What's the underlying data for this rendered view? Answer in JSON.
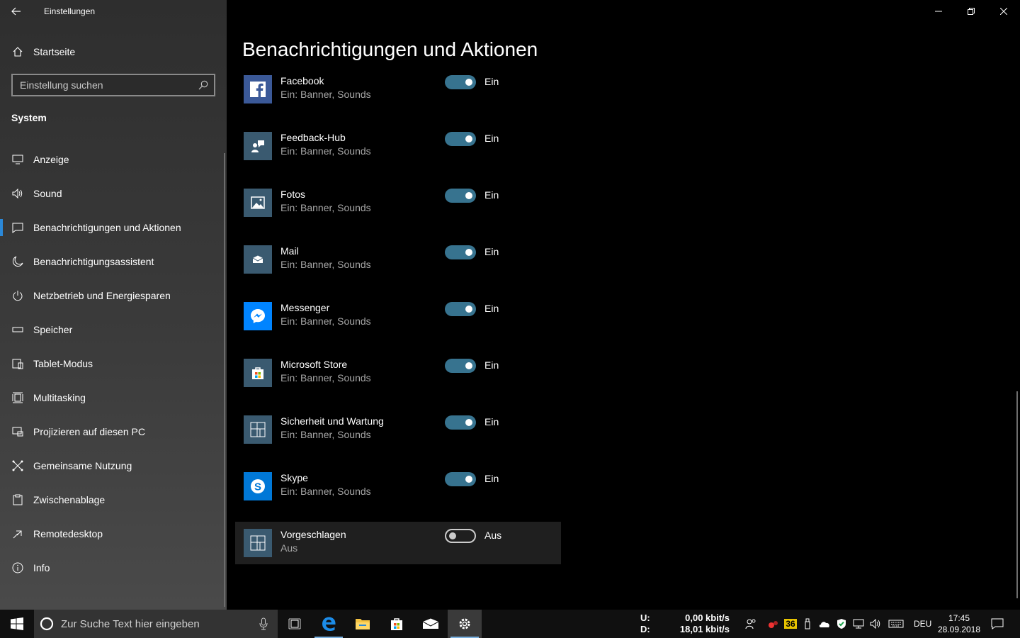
{
  "window": {
    "title": "Einstellungen"
  },
  "sidebar": {
    "home_label": "Startseite",
    "search_placeholder": "Einstellung suchen",
    "section_title": "System",
    "items": [
      {
        "label": "Anzeige",
        "icon": "display-icon"
      },
      {
        "label": "Sound",
        "icon": "speaker-icon"
      },
      {
        "label": "Benachrichtigungen und Aktionen",
        "icon": "notification-icon",
        "active": true
      },
      {
        "label": "Benachrichtigungsassistent",
        "icon": "moon-icon"
      },
      {
        "label": "Netzbetrieb und Energiesparen",
        "icon": "power-icon"
      },
      {
        "label": "Speicher",
        "icon": "storage-icon"
      },
      {
        "label": "Tablet-Modus",
        "icon": "tablet-icon"
      },
      {
        "label": "Multitasking",
        "icon": "multitasking-icon"
      },
      {
        "label": "Projizieren auf diesen PC",
        "icon": "project-icon"
      },
      {
        "label": "Gemeinsame Nutzung",
        "icon": "share-icon"
      },
      {
        "label": "Zwischenablage",
        "icon": "clipboard-icon"
      },
      {
        "label": "Remotedesktop",
        "icon": "remote-icon"
      },
      {
        "label": "Info",
        "icon": "info-icon"
      }
    ]
  },
  "main": {
    "title": "Benachrichtigungen und Aktionen",
    "apps": [
      {
        "name": "Facebook",
        "status": "Ein: Banner, Sounds",
        "toggle": "Ein",
        "on": true,
        "icon": "facebook-icon",
        "color": "#3b5998"
      },
      {
        "name": "Feedback-Hub",
        "status": "Ein: Banner, Sounds",
        "toggle": "Ein",
        "on": true,
        "icon": "feedback-hub-icon",
        "color": "#3a5a70"
      },
      {
        "name": "Fotos",
        "status": "Ein: Banner, Sounds",
        "toggle": "Ein",
        "on": true,
        "icon": "photos-icon",
        "color": "#3a5a70"
      },
      {
        "name": "Mail",
        "status": "Ein: Banner, Sounds",
        "toggle": "Ein",
        "on": true,
        "icon": "mail-icon",
        "color": "#3a5a70"
      },
      {
        "name": "Messenger",
        "status": "Ein: Banner, Sounds",
        "toggle": "Ein",
        "on": true,
        "icon": "messenger-icon",
        "color": "#0084ff"
      },
      {
        "name": "Microsoft Store",
        "status": "Ein: Banner, Sounds",
        "toggle": "Ein",
        "on": true,
        "icon": "store-icon",
        "color": "#3a5a70"
      },
      {
        "name": "Sicherheit und Wartung",
        "status": "Ein: Banner, Sounds",
        "toggle": "Ein",
        "on": true,
        "icon": "security-icon",
        "color": "#3a5a70"
      },
      {
        "name": "Skype",
        "status": "Ein: Banner, Sounds",
        "toggle": "Ein",
        "on": true,
        "icon": "skype-icon",
        "color": "#0078d7"
      },
      {
        "name": "Vorgeschlagen",
        "status": "Aus",
        "toggle": "Aus",
        "on": false,
        "icon": "suggested-icon",
        "color": "#3a5a70"
      }
    ]
  },
  "taskbar": {
    "search_placeholder": "Zur Suche Text hier eingeben",
    "net_up_label": "U:",
    "net_down_label": "D:",
    "net_up_value": "0,00 kbit/s",
    "net_down_value": "18,01 kbit/s",
    "tray_badge": "36",
    "language": "DEU",
    "time": "17:45",
    "date": "28.09.2018"
  },
  "colors": {
    "accent": "#2b88d8",
    "toggle_on": "#37738f",
    "sidebar_bg": "#3b3b3b"
  }
}
